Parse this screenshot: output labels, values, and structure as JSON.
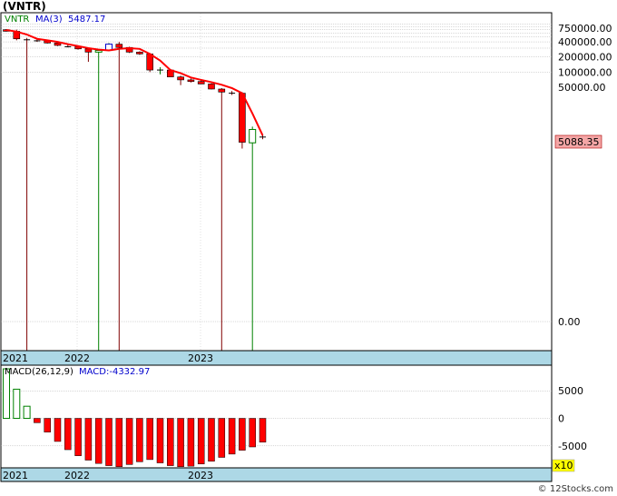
{
  "title": "(VNTR)",
  "footer": "© 12Stocks.com",
  "colors": {
    "up": "#008000",
    "down": "#ff0000",
    "ma_line": "#ff0000",
    "wick_down": "#800000",
    "axis_band": "#add8e6",
    "price_badge_bg": "#f4a6a6",
    "multiplier_bg": "#ffff00"
  },
  "chart_data": [
    {
      "type": "candlestick",
      "scale": "log",
      "legend": {
        "ticker": "VNTR",
        "ma_label": "MA(3)",
        "ma_value": "5487.17"
      },
      "y_tick_labels": [
        "750000.00",
        "400000.00",
        "200000.00",
        "100000.00",
        "50000.00",
        "0.00"
      ],
      "x_tick_labels": [
        "2021",
        "2022",
        "2023"
      ],
      "last_price_label": "5088.35",
      "candles": [
        {
          "open": 700000,
          "high": 720000,
          "low": 640000,
          "close": 650000
        },
        {
          "open": 650000,
          "high": 700000,
          "low": 430000,
          "close": 460000
        },
        {
          "open": 460000,
          "high": 480000,
          "low": 0.02,
          "close": 440000
        },
        {
          "open": 440000,
          "high": 460000,
          "low": 400000,
          "close": 420000
        },
        {
          "open": 420000,
          "high": 440000,
          "low": 370000,
          "close": 380000
        },
        {
          "open": 380000,
          "high": 400000,
          "low": 330000,
          "close": 340000
        },
        {
          "open": 340000,
          "high": 360000,
          "low": 310000,
          "close": 320000
        },
        {
          "open": 320000,
          "high": 340000,
          "low": 280000,
          "close": 290000
        },
        {
          "open": 290000,
          "high": 300000,
          "low": 160000,
          "close": 250000
        },
        {
          "open": 250000,
          "high": 270000,
          "low": 0.01,
          "close": 270000
        },
        {
          "open": 270000,
          "high": 380000,
          "low": 260000,
          "close": 360000
        },
        {
          "open": 360000,
          "high": 400000,
          "low": 0.01,
          "close": 310000
        },
        {
          "open": 310000,
          "high": 320000,
          "low": 240000,
          "close": 250000
        },
        {
          "open": 250000,
          "high": 260000,
          "low": 220000,
          "close": 230000
        },
        {
          "open": 230000,
          "high": 240000,
          "low": 100000,
          "close": 110000
        },
        {
          "open": 110000,
          "high": 125000,
          "low": 90000,
          "close": 110000
        },
        {
          "open": 110000,
          "high": 115000,
          "low": 80000,
          "close": 80000
        },
        {
          "open": 80000,
          "high": 85000,
          "low": 55000,
          "close": 70000
        },
        {
          "open": 70000,
          "high": 75000,
          "low": 62000,
          "close": 65000
        },
        {
          "open": 65000,
          "high": 70000,
          "low": 58000,
          "close": 58000
        },
        {
          "open": 58000,
          "high": 60000,
          "low": 45000,
          "close": 46000
        },
        {
          "open": 46000,
          "high": 48000,
          "low": 0.005,
          "close": 40000
        },
        {
          "open": 40000,
          "high": 42000,
          "low": 35000,
          "close": 38000
        },
        {
          "open": 38000,
          "high": 40000,
          "low": 3000,
          "close": 4000
        },
        {
          "open": 3900,
          "high": 8200,
          "low": 0.002,
          "close": 7200
        },
        {
          "open": 5100,
          "high": 5600,
          "low": 4600,
          "close": 5088
        }
      ],
      "ma": [
        690000,
        640000,
        560000,
        460000,
        430000,
        400000,
        360000,
        330000,
        300000,
        280000,
        270000,
        290000,
        300000,
        290000,
        230000,
        170000,
        110000,
        95000,
        78000,
        70000,
        63000,
        56000,
        48000,
        38000,
        15000,
        5487
      ]
    },
    {
      "type": "bar",
      "legend": {
        "label": "MACD(26,12,9)",
        "value_label": "MACD:-4332.97"
      },
      "y_tick_labels": [
        "5000",
        "0",
        "-5000"
      ],
      "ylim": [
        -9000,
        9500
      ],
      "x_tick_labels": [
        "2021",
        "2022",
        "2023"
      ],
      "multiplier_label": "x10",
      "values": [
        9000,
        5300,
        2200,
        -800,
        -2500,
        -4200,
        -5700,
        -6800,
        -7600,
        -8200,
        -8600,
        -8800,
        -8400,
        -7900,
        -7500,
        -8100,
        -8600,
        -8800,
        -8700,
        -8300,
        -7800,
        -7100,
        -6500,
        -5800,
        -5200,
        -4330
      ]
    }
  ]
}
